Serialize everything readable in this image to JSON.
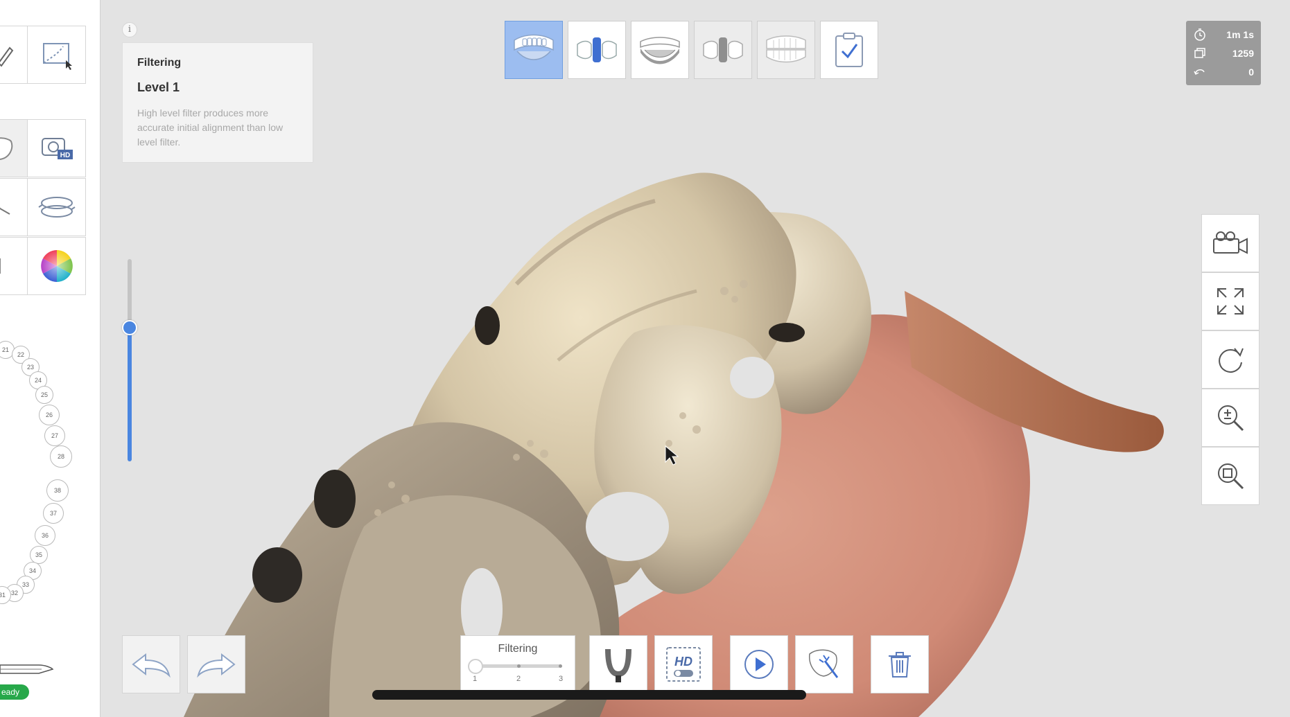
{
  "info": {
    "icon": "i",
    "title": "Filtering",
    "level": "Level 1",
    "description": "High level filter produces more accurate initial alignment than low level filter."
  },
  "stats": [
    {
      "icon": "timer-icon",
      "value": "1m 1s"
    },
    {
      "icon": "frames-icon",
      "value": "1259"
    },
    {
      "icon": "undo-count-icon",
      "value": "0"
    }
  ],
  "tooth_chart": {
    "upper": [
      "21",
      "22",
      "23",
      "24",
      "25",
      "26",
      "27",
      "28"
    ],
    "lower": [
      "38",
      "37",
      "36",
      "35",
      "34",
      "33",
      "32",
      "31"
    ]
  },
  "status": {
    "ready_label": "eady"
  },
  "filter_widget": {
    "label": "Filtering",
    "ticks": [
      "1",
      "2",
      "3"
    ],
    "selected": 1
  },
  "stages": [
    {
      "name": "maxilla-stage",
      "active": true
    },
    {
      "name": "maxilla-scanbody-stage",
      "active": false
    },
    {
      "name": "mandible-stage",
      "active": false
    },
    {
      "name": "mandible-scanbody-stage",
      "active": false
    },
    {
      "name": "occlusion-stage",
      "active": false
    },
    {
      "name": "review-stage",
      "active": false
    }
  ],
  "vertical_slider": {
    "value_fraction": 0.66
  },
  "colors": {
    "accent": "#4a86e0",
    "active_stage": "#9cbdf0",
    "ready": "#27a84a",
    "background": "#e3e3e3"
  }
}
